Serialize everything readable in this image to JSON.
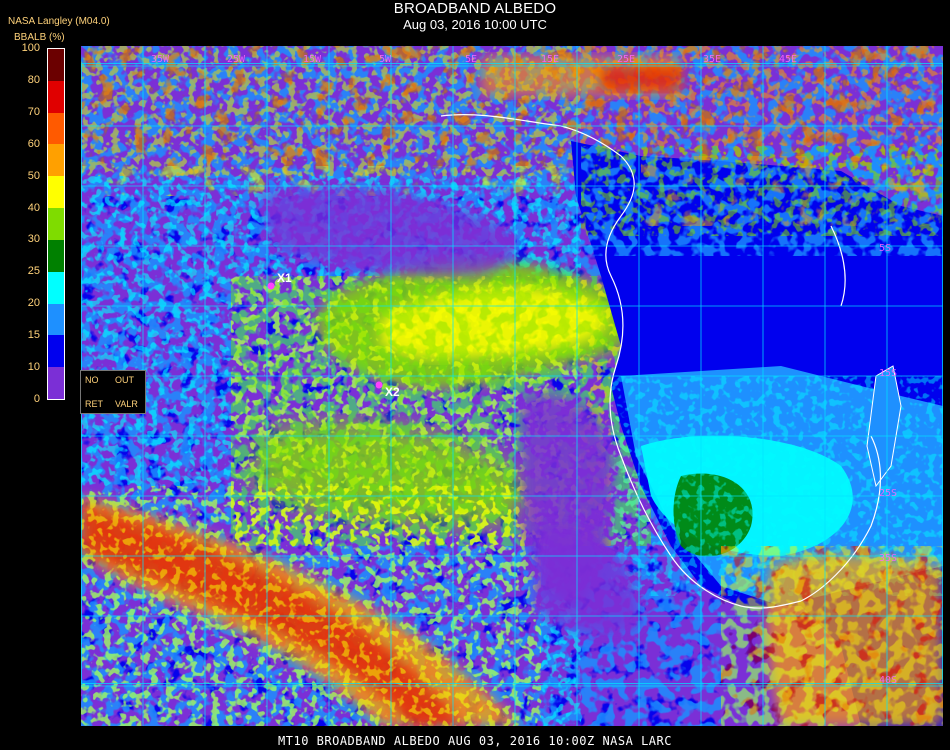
{
  "header": {
    "title": "BROADBAND ALBEDO",
    "datetime": "Aug 03, 2016 10:00 UTC",
    "producer": "NASA Langley (M04.0)",
    "units": "BBALB (%)"
  },
  "colorbar": {
    "ticks": [
      "100",
      "80",
      "70",
      "60",
      "50",
      "40",
      "30",
      "25",
      "20",
      "15",
      "10",
      "0"
    ],
    "bins": [
      {
        "range": "80-100",
        "color": "#6b0000"
      },
      {
        "range": "70-80",
        "color": "#e00000"
      },
      {
        "range": "60-70",
        "color": "#ff5a00"
      },
      {
        "range": "50-60",
        "color": "#ffa000"
      },
      {
        "range": "40-50",
        "color": "#ffff00"
      },
      {
        "range": "30-40",
        "color": "#7fdc00"
      },
      {
        "range": "25-30",
        "color": "#008000"
      },
      {
        "range": "20-25",
        "color": "#00ffff"
      },
      {
        "range": "15-20",
        "color": "#1e90ff"
      },
      {
        "range": "10-15",
        "color": "#0000ee"
      },
      {
        "range": "0-10",
        "color": "#7b2fd6"
      }
    ]
  },
  "no_data_legend": {
    "labels": [
      "NO",
      "OUT",
      "RET",
      "VALR"
    ]
  },
  "map": {
    "markers": [
      {
        "label": "X1"
      },
      {
        "label": "X2"
      }
    ],
    "top_lon_labels": [
      "35W",
      "25W",
      "15W",
      "5W",
      "5E",
      "15E",
      "25E",
      "35E",
      "45E"
    ],
    "right_lat_labels": [
      "5S",
      "15S",
      "25S",
      "35S",
      "40S"
    ],
    "colors": {
      "ocean_clear": "#7b2fd6",
      "land_low": "#0000ee",
      "land_mid": "#1e90ff",
      "desert": "#00ffff",
      "vegetation": "#008000",
      "grid": "#00e5ff",
      "coast": "#ffffff",
      "marker": "#ff40ff"
    }
  },
  "footer": {
    "caption": "MT10  BROADBAND ALBEDO   AUG 03, 2016 10:00Z   NASA LARC"
  }
}
